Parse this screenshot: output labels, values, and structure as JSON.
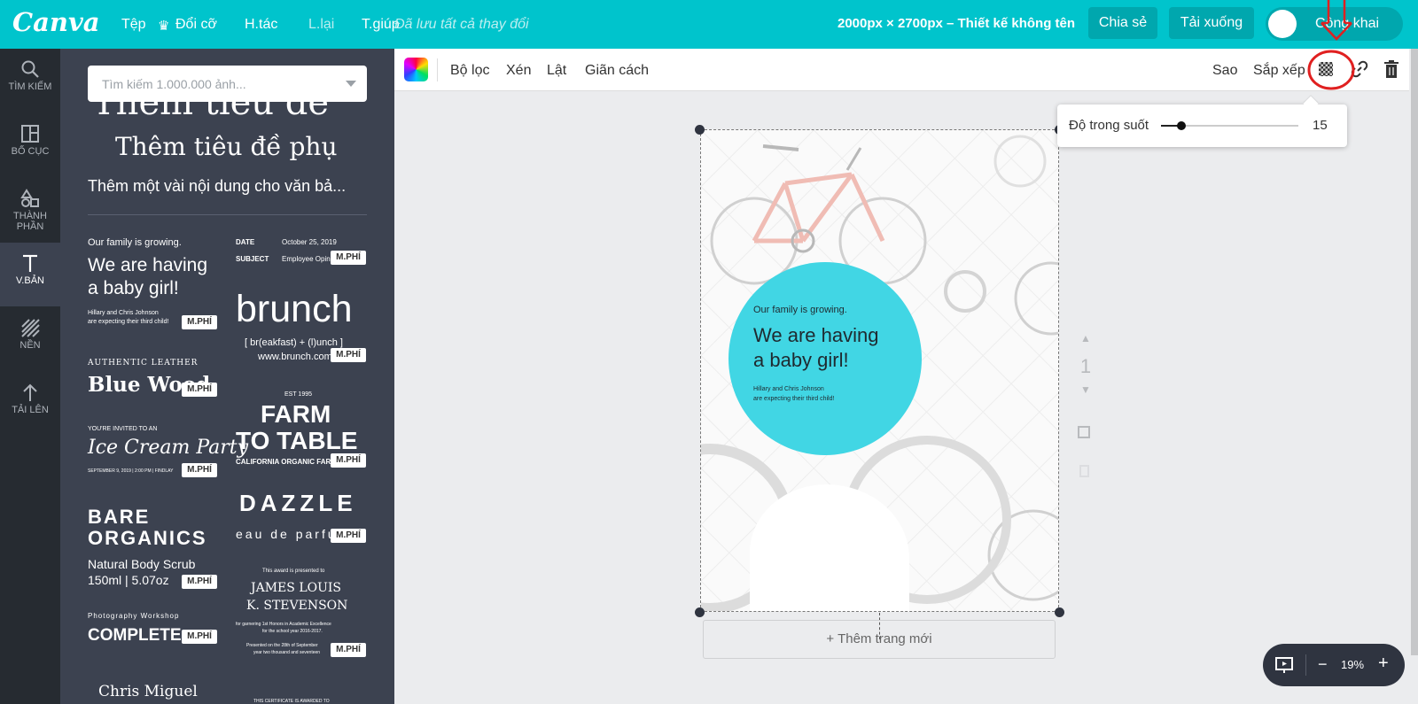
{
  "topbar": {
    "logo": "Canva",
    "menu": [
      "Tệp",
      "Đổi cỡ",
      "H.tác",
      "L.lại",
      "T.giúp"
    ],
    "saved": "Đã lưu tất cả thay đổi",
    "doc_title": "2000px × 2700px – Thiết kế không tên",
    "share": "Chia sẻ",
    "download": "Tải xuống",
    "public": "Công khai"
  },
  "rail": [
    {
      "label": "TÌM KIẾM",
      "icon": "search-icon"
    },
    {
      "label": "BỐ CỤC",
      "icon": "layout-icon"
    },
    {
      "label": "THÀNH PHẦN",
      "icon": "elements-icon"
    },
    {
      "label": "V.BẢN",
      "icon": "text-icon"
    },
    {
      "label": "NỀN",
      "icon": "background-icon"
    },
    {
      "label": "TẢI LÊN",
      "icon": "upload-icon"
    }
  ],
  "panel": {
    "search_placeholder": "Tìm kiếm 1.000.000 ảnh...",
    "heading_partial": "Thêm tiêu đề",
    "subheading": "Thêm tiêu đề phụ",
    "body": "Thêm một vài nội dung cho văn bả...",
    "badge": "M.PHÍ",
    "t1": {
      "a": "Our family is growing.",
      "b": "We are having",
      "c": "a baby girl!",
      "d": "Hillary and Chris Johnson",
      "e": "are expecting their third child!"
    },
    "t2": {
      "a": "DATE",
      "b": "October 25, 2019",
      "c": "SUBJECT",
      "d": "Employee Opinions"
    },
    "t3": {
      "a": "brunch",
      "b": "[ br(eakfast) + (l)unch ]",
      "c": "www.brunch.com"
    },
    "t4": {
      "a": "AUTHENTIC LEATHER",
      "b": "Blue Wood"
    },
    "t5": {
      "a": "EST 1995",
      "b": "FARM",
      "c": "TO TABLE",
      "d": "CALIFORNIA ORGANIC FARM"
    },
    "t6": {
      "a": "YOU'RE INVITED TO AN",
      "b": "Ice Cream Party",
      "c": "SEPTEMBER 9, 2019 | 2:00 PM | FINDLAY"
    },
    "t7": {
      "a": "DAZZLE",
      "b": "eau de parfum"
    },
    "t8": {
      "a": "BARE",
      "b": "ORGANICS",
      "c": "Natural Body Scrub",
      "d": "150ml | 5.07oz"
    },
    "t9": {
      "a": "This award is presented to",
      "b": "JAMES LOUIS",
      "c": "K. STEVENSON",
      "d": "for garnering 1st Honors in Academic Excellence",
      "e": "for the school year 2016-2017.",
      "f": "Presented on the 28th of September",
      "g": "year two thousand and seventeen"
    },
    "t10": {
      "a": "Photography Workshop",
      "b": "COMPLETE"
    },
    "t11": {
      "a": "Chris Miguel"
    },
    "t12": {
      "a": "THIS CERTIFICATE IS AWARDED TO"
    }
  },
  "toolbar": {
    "filter": "Bộ lọc",
    "crop": "Xén",
    "flip": "Lật",
    "spacing": "Giãn cách",
    "copy": "Sao",
    "arrange": "Sắp xếp"
  },
  "transparency": {
    "label": "Độ trong suốt",
    "value": "15",
    "level": 0.15
  },
  "design": {
    "line1": "Our family is growing.",
    "line2": "We are having",
    "line3": "a baby girl!",
    "line4": "Hillary and Chris Johnson",
    "line5": "are expecting their third child!"
  },
  "page_controls": {
    "page_number": "1"
  },
  "add_page": "+ Thêm trang mới",
  "zoom": {
    "value": "19%",
    "minus": "−",
    "plus": "+"
  },
  "colors": {
    "teal": "#00c4cc",
    "circle": "#41d6e4",
    "annotation": "#e02020"
  }
}
